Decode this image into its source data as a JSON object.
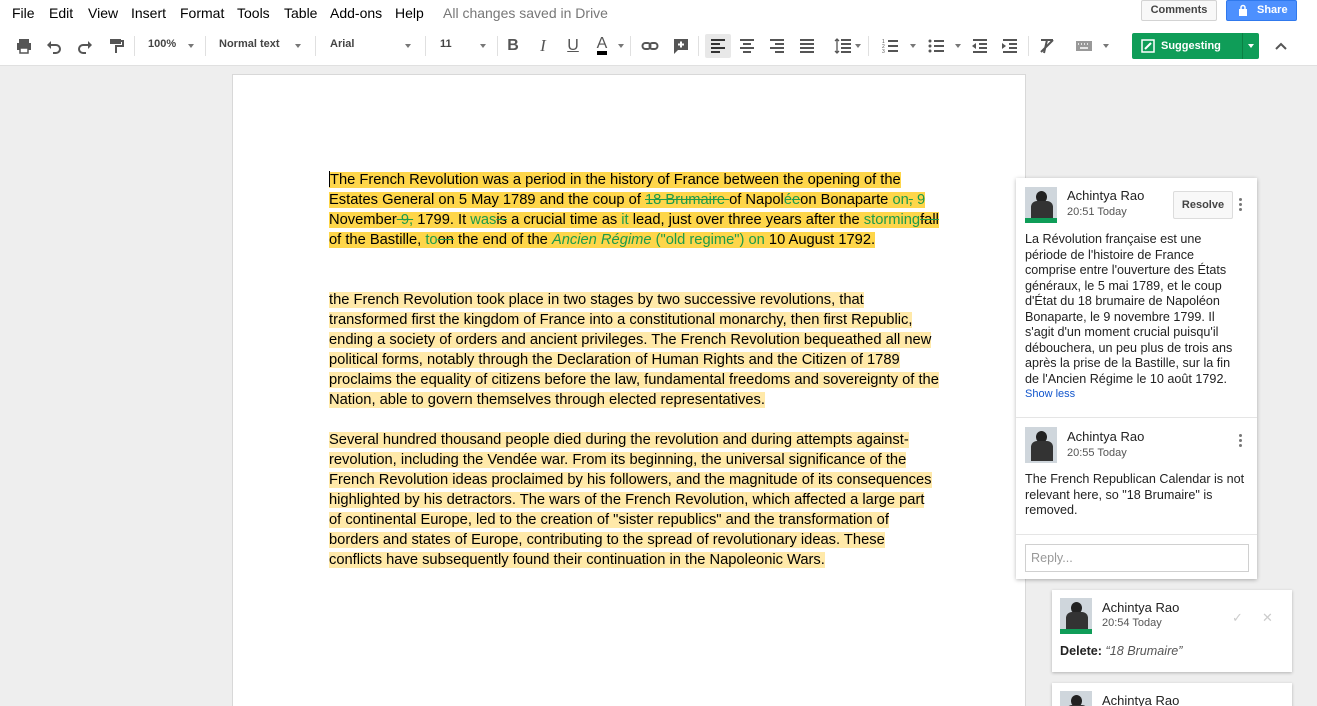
{
  "menu": {
    "items": [
      "File",
      "Edit",
      "View",
      "Insert",
      "Format",
      "Tools",
      "Table",
      "Add-ons",
      "Help"
    ],
    "saved_status": "All changes saved in Drive",
    "comments_label": "Comments",
    "share_label": "Share"
  },
  "toolbar": {
    "zoom": "100%",
    "style": "Normal text",
    "font": "Arial",
    "size": "11",
    "mode_label": "Suggesting",
    "icons": [
      "print-icon",
      "undo-icon",
      "redo-icon",
      "paint-format-icon",
      "bold-icon",
      "italic-icon",
      "underline-icon",
      "text-color-icon",
      "link-icon",
      "add-comment-icon",
      "align-left-icon",
      "align-center-icon",
      "align-right-icon",
      "justify-icon",
      "line-spacing-icon",
      "numbered-list-icon",
      "bulleted-list-icon",
      "decrease-indent-icon",
      "increase-indent-icon",
      "clear-formatting-icon",
      "input-tools-icon",
      "collapse-icon"
    ]
  },
  "doc": {
    "p1": {
      "s1": "The French Revolution was a period in the history of France between the opening of the Estates General on 5 May 1789 and the coup of ",
      "del1": "18 Brumaire ",
      "s2": "of Napol",
      "ins1": "é",
      "del2": "e",
      "s3": "on Bonaparte ",
      "ins2": "on",
      "del3": ",",
      "ins3": " 9",
      "s4": " November",
      "del4": " 9,",
      "s5": " 1799. It ",
      "ins4": "was",
      "del5": "is",
      "s6": " a crucial time as ",
      "ins5": "it",
      "s7": " lead, just over three years after the ",
      "ins6": "storming",
      "del6": "fall",
      "s8": " of the Bastille, ",
      "ins7": "to",
      "del7": "on",
      "s9": " the end of the ",
      "ins8": "Ancien Régime",
      "ins9": " (\"old regime\") on",
      "s10": " 10 August 1792."
    },
    "p2": "the French Revolution took place in two stages by two successive revolutions, that transformed first the kingdom of France into a constitutional monarchy, then first Republic, ending a society of orders and ancient privileges. The French Revolution bequeathed all new political forms, notably through the Declaration of Human Rights and the Citizen of 1789 proclaims the equality of citizens before the law, fundamental freedoms and sovereignty of the Nation, able to govern themselves through elected representatives.",
    "p3": "Several hundred thousand people died during the revolution and during attempts against-revolution, including the Vendée war. From its beginning, the universal significance of the French Revolution ideas proclaimed by his followers, and the magnitude of its consequences highlighted by his detractors. The wars of the French Revolution, which affected a large part of continental Europe, led to the creation of \"sister republics\" and the transformation of borders and states of Europe, contributing to the spread of revolutionary ideas. These conflicts have subsequently found their continuation in the Napoleonic Wars."
  },
  "comment": {
    "author": "Achintya Rao",
    "time": "20:51 Today",
    "resolve_label": "Resolve",
    "text": "La Révolution française est une période de l'histoire de France comprise entre l'ouverture des États généraux, le 5 mai 1789, et le coup d'État du 18 brumaire de Napoléon Bonaparte, le 9 novembre 1799. Il s'agit d'un moment crucial puisqu'il débouchera, un peu plus de trois ans après la prise de la Bastille, sur la fin de l'Ancien Régime le 10 août 1792.",
    "show_less": "Show less",
    "reply_author": "Achintya Rao",
    "reply_time": "20:55 Today",
    "reply_text": "The French Republican Calendar is not relevant here, so \"18 Brumaire\" is removed.",
    "reply_placeholder": "Reply..."
  },
  "suggestions": [
    {
      "author": "Achintya Rao",
      "time": "20:54 Today",
      "action": "Delete:",
      "target": "“18 Brumaire”"
    },
    {
      "author": "Achintya Rao"
    }
  ],
  "colors": {
    "accent_green": "#0f9d58",
    "share_blue": "#4d90fe",
    "highlight": "#ffe9a9",
    "highlight_strong": "#fed64a",
    "suggestion_text": "#1e9a4a"
  }
}
